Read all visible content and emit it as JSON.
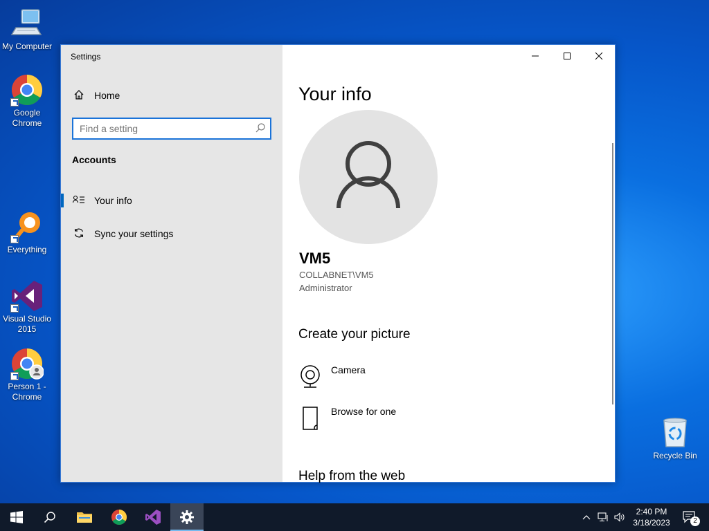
{
  "desktop": {
    "icons": [
      {
        "label": "My Computer"
      },
      {
        "label": "Google Chrome"
      },
      {
        "label": "Everything"
      },
      {
        "label": "Visual Studio 2015"
      },
      {
        "label": "Person 1 - Chrome"
      },
      {
        "label": "Recycle Bin"
      }
    ]
  },
  "window": {
    "title": "Settings",
    "controls": {
      "minimize": "minimize-icon",
      "maximize": "maximize-icon",
      "close": "close-icon"
    }
  },
  "sidebar": {
    "home_label": "Home",
    "search_placeholder": "Find a setting",
    "section_title": "Accounts",
    "items": [
      {
        "label": "Your info",
        "icon": "contact-info-icon",
        "selected": true
      },
      {
        "label": "Sync your settings",
        "icon": "sync-icon",
        "selected": false
      }
    ]
  },
  "main": {
    "title": "Your info",
    "user": {
      "name": "VM5",
      "account": "COLLABNET\\VM5",
      "role": "Administrator"
    },
    "create_picture": {
      "title": "Create your picture",
      "options": [
        {
          "label": "Camera",
          "icon": "camera-icon"
        },
        {
          "label": "Browse for one",
          "icon": "browse-icon"
        }
      ]
    },
    "help_title": "Help from the web"
  },
  "taskbar": {
    "time": "2:40 PM",
    "date": "3/18/2023",
    "notification_count": "2",
    "accent": "#76b9ed"
  }
}
